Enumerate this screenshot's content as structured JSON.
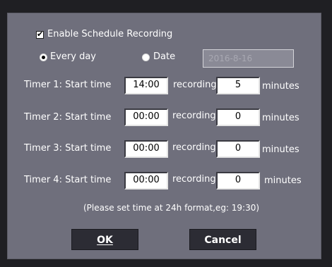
{
  "schedule": {
    "enable_label": "Enable Schedule Recording",
    "enabled": true
  },
  "repeat": {
    "every_day_label": "Every day",
    "every_day_selected": true,
    "date_label": "Date",
    "date_selected": false,
    "date_value": "2016-8-16"
  },
  "timers": [
    {
      "label": "Timer 1: Start time",
      "start": "14:00",
      "recording_label": "recording",
      "duration": "5",
      "unit": "minutes"
    },
    {
      "label": "Timer 2: Start time",
      "start": "00:00",
      "recording_label": "recording",
      "duration": "0",
      "unit": "minutes"
    },
    {
      "label": "Timer 3: Start time",
      "start": "00:00",
      "recording_label": "recording",
      "duration": "0",
      "unit": "minutes"
    },
    {
      "label": "Timer 4: Start time",
      "start": "00:00",
      "recording_label": "recording",
      "duration": "0",
      "unit": "minutes"
    }
  ],
  "hint": "(Please set time at 24h format,eg: 19:30)",
  "buttons": {
    "ok_label": "OK",
    "cancel_label": "Cancel"
  },
  "colors": {
    "dialog_bg": "#6f6f7c",
    "button_bg": "#2c2c34",
    "text": "#ffffff"
  }
}
